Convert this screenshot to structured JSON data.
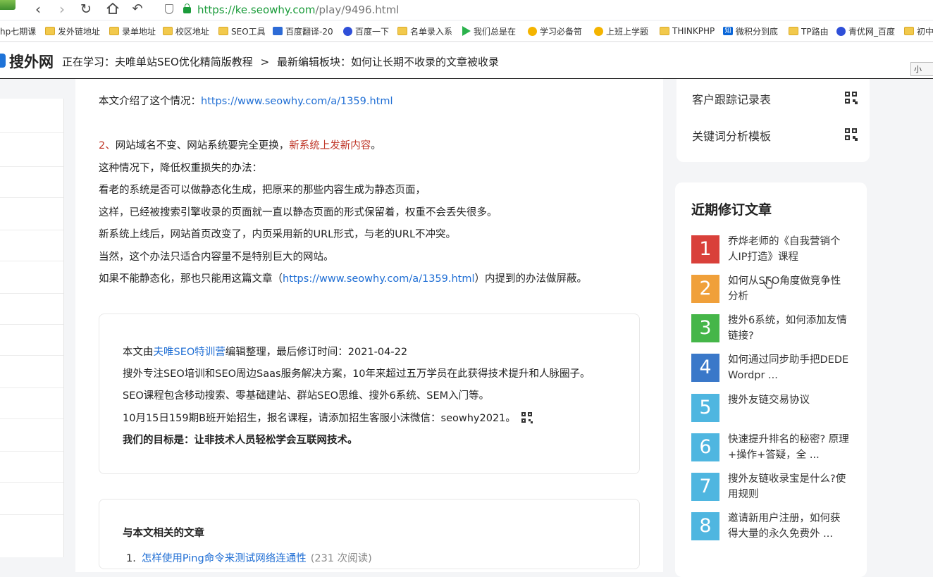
{
  "browser": {
    "url_scheme": "https://",
    "url_host": "ke.seowhy.com",
    "url_path": "/play/9496.html",
    "bookmarks": [
      {
        "label": "hp七期课",
        "icon": "none"
      },
      {
        "label": "发外链地址",
        "icon": "folder-icon"
      },
      {
        "label": "录单地址",
        "icon": "folder-icon"
      },
      {
        "label": "校区地址",
        "icon": "folder-icon"
      },
      {
        "label": "SEO工具",
        "icon": "folder-icon"
      },
      {
        "label": "百度翻译-20",
        "icon": "translate-icon"
      },
      {
        "label": "百度一下",
        "icon": "baidu-paw-icon"
      },
      {
        "label": "名单录入系",
        "icon": "folder-icon"
      },
      {
        "label": "我们总是在",
        "icon": "play-icon"
      },
      {
        "label": "学习必备笥",
        "icon": "bee-icon"
      },
      {
        "label": "上班上学题",
        "icon": "bee-icon"
      },
      {
        "label": "THINKPHP",
        "icon": "folder-icon"
      },
      {
        "label": "微积分到底",
        "icon": "zhihu-icon"
      },
      {
        "label": "TP路由",
        "icon": "folder-icon"
      },
      {
        "label": "青优网_百度",
        "icon": "baidu-paw-icon"
      },
      {
        "label": "初中",
        "icon": "folder-icon"
      }
    ]
  },
  "header": {
    "logo": "搜外网",
    "crumb_prefix": "正在学习：夫唯单站SEO优化精简版教程",
    "crumb_sep": ">",
    "crumb_current": "最新编辑板块：如何让长期不收录的文章被收录",
    "pip_label": "小"
  },
  "article": {
    "top_partial": "本文介绍了这个情况：",
    "top_partial_link": "https://www.seowhy.com/a/1359.html",
    "point2_num": "2、",
    "point2_text": "网站域名不变、网站系统要完全更换，",
    "point2_red": "新系统上发新内容",
    "point2_end": "。",
    "p1": "这种情况下，降低权重损失的办法：",
    "p2": "看老的系统是否可以做静态化生成，把原来的那些内容生成为静态页面，",
    "p3": "这样，已经被搜索引擎收录的页面就一直以静态页面的形式保留着，权重不会丢失很多。",
    "p4": "新系统上线后，网站首页改变了，内页采用新的URL形式，与老的URL不冲突。",
    "p5": "当然，这个办法只适合内容量不是特别巨大的网站。",
    "p6_a": "如果不能静态化，那也只能用这篇文章（",
    "p6_link": "https://www.seowhy.com/a/1359.html",
    "p6_b": "）内提到的办法做屏蔽。"
  },
  "info": {
    "l1_a": "本文由",
    "l1_link": "夫唯SEO特训营",
    "l1_b": "编辑整理，最后修订时间：2021-04-22",
    "l2": "搜外专注SEO培训和SEO周边Saas服务解决方案，10年来超过五万学员在此获得技术提升和人脉圈子。",
    "l3": "SEO课程包含移动搜索、零基础建站、群站SEO思维、搜外6系统、SEM入门等。",
    "l4": "10月15日159期B班开始招生，报名课程，请添加招生客服小沫微信：seowhy2021。",
    "l5": "我们的目标是：让非技术人员轻松学会互联网技术。"
  },
  "related": {
    "title": "与本文相关的文章",
    "items": [
      {
        "num": "1.",
        "title": "怎样使用Ping命令来测试网络连通性",
        "reads": "(231 次阅读)"
      }
    ]
  },
  "sidebar": {
    "card1_items": [
      {
        "label": "客户跟踪记录表"
      },
      {
        "label": "关键词分析模板"
      }
    ],
    "recent_title": "近期修订文章",
    "recent": [
      {
        "num": "1",
        "color": "#d9403a",
        "title": "乔烨老师的《自我营销个人IP打造》课程"
      },
      {
        "num": "2",
        "color": "#f0a03a",
        "title": "如何从SEO角度做竞争性分析"
      },
      {
        "num": "3",
        "color": "#45b649",
        "title": "搜外6系统，如何添加友情链接?"
      },
      {
        "num": "4",
        "color": "#3a78c9",
        "title": "如何通过同步助手把DEDE Wordpr ..."
      },
      {
        "num": "5",
        "color": "#4fb6e0",
        "title": "搜外友链交易协议"
      },
      {
        "num": "6",
        "color": "#4fb6e0",
        "title": "快速提升排名的秘密? 原理+操作+答疑，全 ..."
      },
      {
        "num": "7",
        "color": "#4fb6e0",
        "title": "搜外友链收录宝是什么?使用规则"
      },
      {
        "num": "8",
        "color": "#4fb6e0",
        "title": "邀请新用户注册，如何获得大量的永久免费外 ..."
      }
    ]
  }
}
